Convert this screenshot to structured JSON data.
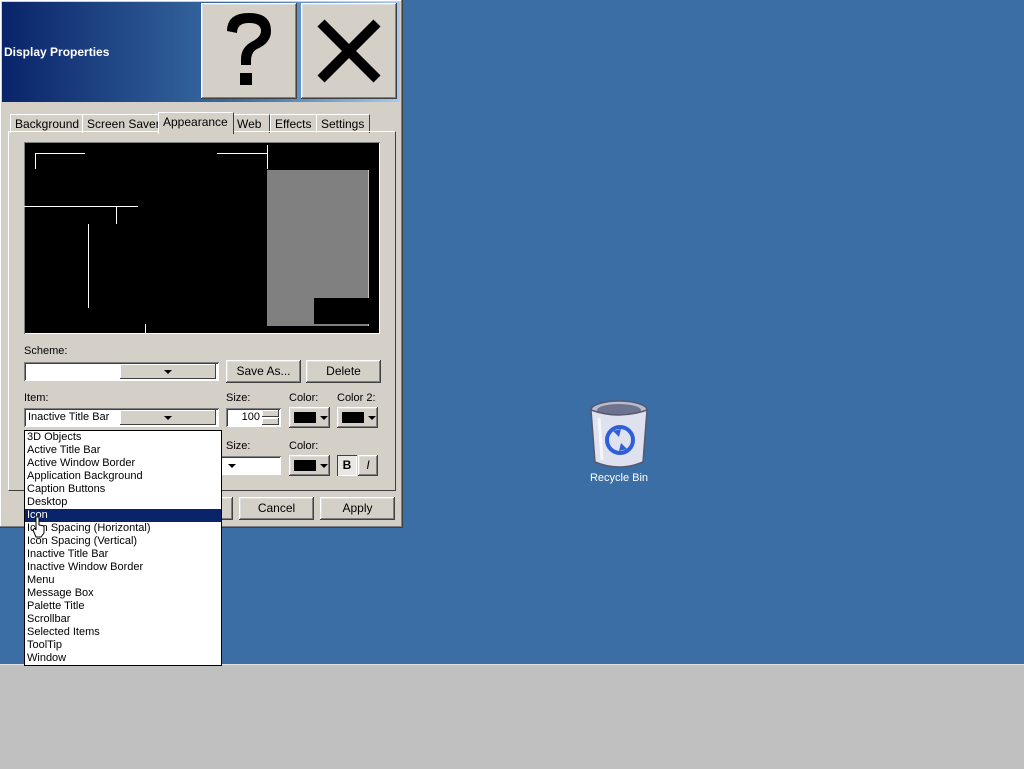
{
  "dialog": {
    "title": "Display Properties",
    "tabs": [
      "Background",
      "Screen Saver",
      "Appearance",
      "Web",
      "Effects",
      "Settings"
    ],
    "active_tab": "Appearance"
  },
  "scheme": {
    "label": "Scheme:",
    "value": "",
    "save_as": "Save As...",
    "delete": "Delete"
  },
  "item": {
    "label": "Item:",
    "value": "Inactive Title Bar",
    "size_label": "Size:",
    "size_value": "100",
    "color_label": "Color:",
    "color2_label": "Color 2:"
  },
  "font": {
    "size_label": "Size:",
    "color_label": "Color:",
    "bold": "B",
    "italic": "I"
  },
  "buttons": {
    "cancel": "Cancel",
    "apply": "Apply"
  },
  "dropdown_items": [
    "3D Objects",
    "Active Title Bar",
    "Active Window Border",
    "Application Background",
    "Caption Buttons",
    "Desktop",
    "Icon",
    "Icon Spacing (Horizontal)",
    "Icon Spacing (Vertical)",
    "Inactive Title Bar",
    "Inactive Window Border",
    "Menu",
    "Message Box",
    "Palette Title",
    "Scrollbar",
    "Selected Items",
    "ToolTip",
    "Window"
  ],
  "dropdown_selected": "Icon",
  "desktop": {
    "recycle_bin": "Recycle Bin"
  },
  "icons": {
    "help": "question-mark-icon",
    "close": "x-close-icon",
    "recycle_bin": "recycle-bin-icon"
  },
  "colors": {
    "desktop": "#3a6ea5",
    "selection": "#0a246a",
    "face": "#d4d0c8",
    "taskbar": "#c0c0c0"
  }
}
